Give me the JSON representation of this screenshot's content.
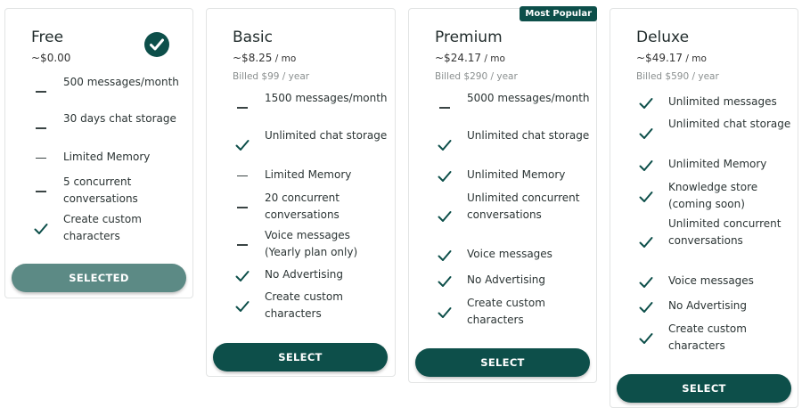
{
  "colors": {
    "primary": "#0d4f4a",
    "selected": "#5c8a85",
    "muted": "#8a8f8f"
  },
  "plans": [
    {
      "name": "Free",
      "price": "~$0.00",
      "unit": "",
      "billed": "",
      "current": true,
      "button": "SELECTED",
      "features": [
        {
          "icon": "dash",
          "text": "500 messages/month"
        },
        {
          "icon": "dash",
          "text": "30 days chat storage"
        },
        {
          "icon": "dash",
          "text": "Limited Memory"
        },
        {
          "icon": "dash",
          "text": "5 concurrent conversations"
        },
        {
          "icon": "check",
          "text": "Create custom characters"
        }
      ]
    },
    {
      "name": "Basic",
      "price": "~$8.25",
      "unit": " / mo",
      "billed": "Billed $99 / year",
      "current": false,
      "button": "SELECT",
      "features": [
        {
          "icon": "dash",
          "text": "1500 messages/month"
        },
        {
          "icon": "check",
          "text": "Unlimited chat storage"
        },
        {
          "icon": "dash",
          "text": "Limited Memory"
        },
        {
          "icon": "dash",
          "text": "20 concurrent conversations"
        },
        {
          "icon": "dash",
          "text": "Voice messages (Yearly plan only)"
        },
        {
          "icon": "check",
          "text": "No Advertising"
        },
        {
          "icon": "check",
          "text": "Create custom characters"
        }
      ]
    },
    {
      "name": "Premium",
      "price": "~$24.17",
      "unit": " / mo",
      "billed": "Billed $290 / year",
      "tag": "Most Popular",
      "current": false,
      "button": "SELECT",
      "features": [
        {
          "icon": "dash",
          "text": "5000 messages/month"
        },
        {
          "icon": "check",
          "text": "Unlimited chat storage"
        },
        {
          "icon": "check",
          "text": "Unlimited Memory"
        },
        {
          "icon": "check",
          "text": "Unlimited concurrent conversations"
        },
        {
          "icon": "check",
          "text": "Voice messages"
        },
        {
          "icon": "check",
          "text": "No Advertising"
        },
        {
          "icon": "check",
          "text": "Create custom characters"
        }
      ]
    },
    {
      "name": "Deluxe",
      "price": "~$49.17",
      "unit": " / mo",
      "billed": "Billed $590 / year",
      "current": false,
      "button": "SELECT",
      "features": [
        {
          "icon": "check",
          "text": "Unlimited messages"
        },
        {
          "icon": "check",
          "text": "Unlimited chat storage"
        },
        {
          "icon": "check",
          "text": "Unlimited Memory"
        },
        {
          "icon": "check",
          "text": "Knowledge store (coming soon)"
        },
        {
          "icon": "check",
          "text": "Unlimited concurrent conversations"
        },
        {
          "icon": "check",
          "text": "Voice messages"
        },
        {
          "icon": "check",
          "text": "No Advertising"
        },
        {
          "icon": "check",
          "text": "Create custom characters"
        }
      ]
    }
  ]
}
